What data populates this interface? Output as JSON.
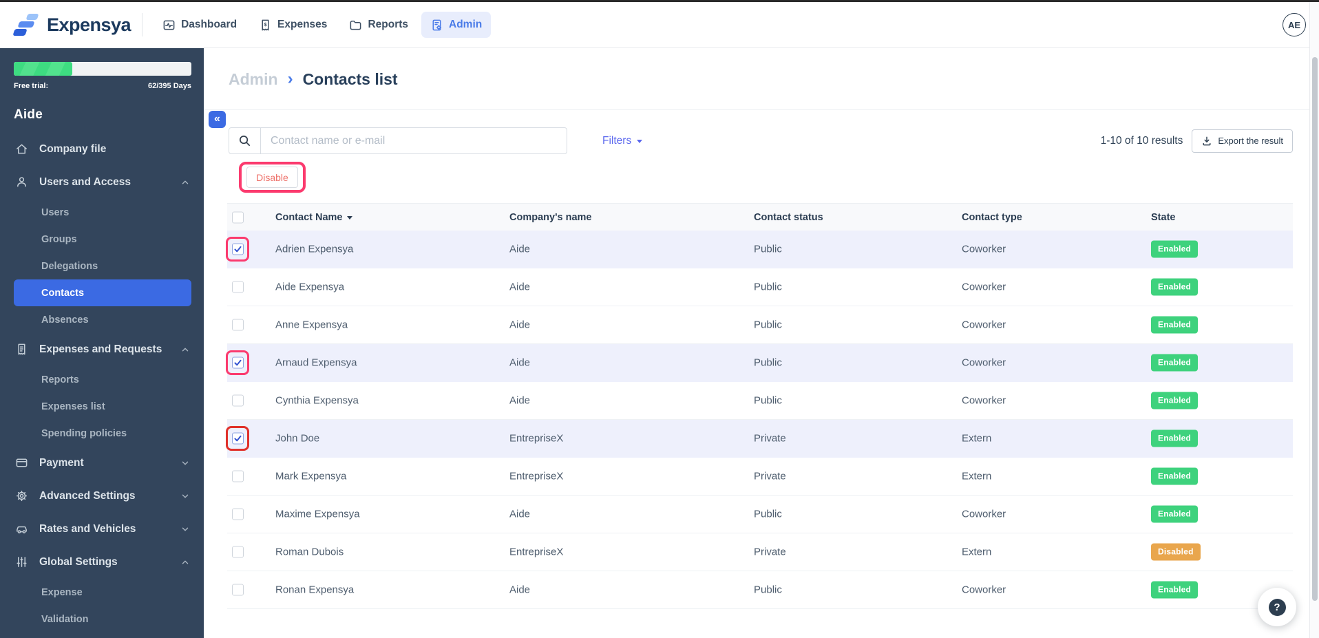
{
  "navbar": {
    "brand": "Expensya",
    "items": [
      {
        "id": "dashboard",
        "label": "Dashboard",
        "active": false
      },
      {
        "id": "expenses",
        "label": "Expenses",
        "active": false
      },
      {
        "id": "reports",
        "label": "Reports",
        "active": false
      },
      {
        "id": "admin",
        "label": "Admin",
        "active": true
      }
    ],
    "avatar_initials": "AE"
  },
  "sidebar": {
    "trial_label": "Free trial:",
    "trial_value": "62/395 Days",
    "trial_progress_percent": 33,
    "company_name": "Aide",
    "menu": [
      {
        "label": "Company file",
        "icon": "home-icon",
        "level": "top"
      },
      {
        "label": "Users and Access",
        "icon": "user-icon",
        "level": "top",
        "chevron": "up"
      },
      {
        "label": "Users",
        "level": "sub"
      },
      {
        "label": "Groups",
        "level": "sub"
      },
      {
        "label": "Delegations",
        "level": "sub"
      },
      {
        "label": "Contacts",
        "level": "sub",
        "active": true
      },
      {
        "label": "Absences",
        "level": "sub"
      },
      {
        "label": "Expenses and Requests",
        "icon": "receipt-icon",
        "level": "top",
        "chevron": "up"
      },
      {
        "label": "Reports",
        "level": "sub"
      },
      {
        "label": "Expenses list",
        "level": "sub"
      },
      {
        "label": "Spending policies",
        "level": "sub"
      },
      {
        "label": "Payment",
        "icon": "card-icon",
        "level": "top",
        "chevron": "down"
      },
      {
        "label": "Advanced Settings",
        "icon": "gear-icon",
        "level": "top",
        "chevron": "down"
      },
      {
        "label": "Rates and Vehicles",
        "icon": "car-icon",
        "level": "top",
        "chevron": "down"
      },
      {
        "label": "Global Settings",
        "icon": "sliders-icon",
        "level": "top",
        "chevron": "up"
      },
      {
        "label": "Expense",
        "level": "sub"
      },
      {
        "label": "Validation",
        "level": "sub"
      }
    ]
  },
  "breadcrumb": {
    "parent": "Admin",
    "separator": "›",
    "current": "Contacts list"
  },
  "toolbar": {
    "search_placeholder": "Contact name or e-mail",
    "filters_label": "Filters",
    "results_text": "1-10 of 10 results",
    "export_label": "Export the result",
    "disable_label": "Disable"
  },
  "table": {
    "columns": [
      "Contact Name",
      "Company's name",
      "Contact status",
      "Contact type",
      "State"
    ],
    "rows": [
      {
        "name": "Adrien Expensya",
        "company": "Aide",
        "status": "Public",
        "type": "Coworker",
        "state": "Enabled",
        "checked": true,
        "annotation": "pink"
      },
      {
        "name": "Aide Expensya",
        "company": "Aide",
        "status": "Public",
        "type": "Coworker",
        "state": "Enabled",
        "checked": false
      },
      {
        "name": "Anne Expensya",
        "company": "Aide",
        "status": "Public",
        "type": "Coworker",
        "state": "Enabled",
        "checked": false
      },
      {
        "name": "Arnaud Expensya",
        "company": "Aide",
        "status": "Public",
        "type": "Coworker",
        "state": "Enabled",
        "checked": true,
        "annotation": "pink"
      },
      {
        "name": "Cynthia Expensya",
        "company": "Aide",
        "status": "Public",
        "type": "Coworker",
        "state": "Enabled",
        "checked": false
      },
      {
        "name": "John Doe",
        "company": "EntrepriseX",
        "status": "Private",
        "type": "Extern",
        "state": "Enabled",
        "checked": true,
        "annotation": "red"
      },
      {
        "name": "Mark Expensya",
        "company": "EntrepriseX",
        "status": "Private",
        "type": "Extern",
        "state": "Enabled",
        "checked": false
      },
      {
        "name": "Maxime Expensya",
        "company": "Aide",
        "status": "Public",
        "type": "Coworker",
        "state": "Enabled",
        "checked": false
      },
      {
        "name": "Roman Dubois",
        "company": "EntrepriseX",
        "status": "Private",
        "type": "Extern",
        "state": "Disabled",
        "checked": false
      },
      {
        "name": "Ronan Expensya",
        "company": "Aide",
        "status": "Public",
        "type": "Coworker",
        "state": "Enabled",
        "checked": false
      }
    ]
  },
  "help": {
    "icon_label": "?"
  },
  "colors": {
    "accent_blue": "#3b6ae3",
    "nav_active_blue": "#4a7be8",
    "enabled_green": "#3ed27d",
    "disabled_orange": "#e9a64d",
    "annotation_pink": "#fb3a6e",
    "annotation_red": "#e0302a",
    "sidebar_bg": "#33455c"
  }
}
